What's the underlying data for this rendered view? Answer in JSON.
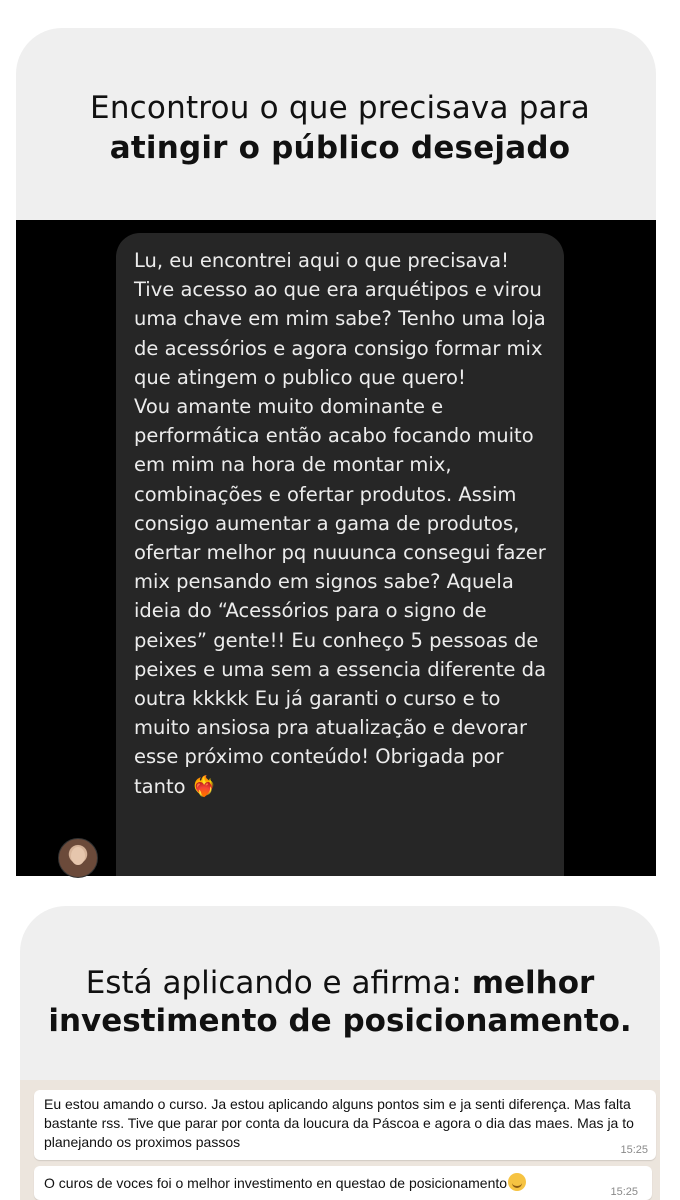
{
  "section1": {
    "headline_light": "Encontrou o que precisava para",
    "headline_bold": "atingir o público desejado"
  },
  "message": {
    "paragraph1": "Lu, eu encontrei aqui o que precisava! Tive acesso ao que era arquétipos e virou uma chave em mim sabe? Tenho uma loja de acessórios e agora consigo formar mix que atingem o publico que quero!",
    "paragraph2": "Vou amante muito dominante e performática então acabo focando muito em mim na hora de montar mix, combinações e ofertar produtos. Assim consigo aumentar a gama de produtos, ofertar melhor pq nuuunca consegui fazer mix pensando em signos sabe? Aquela ideia do “Acessórios para o signo de peixes” gente!! Eu conheço 5 pessoas de peixes e uma sem a essencia diferente da outra kkkkk Eu já garanti o curso e to muito ansiosa pra atualização e devorar esse próximo conteúdo! Obrigada por tanto",
    "emoji": "❤️‍🔥"
  },
  "section2": {
    "headline_light": "Está aplicando e afirma: ",
    "headline_bold_1": "melhor",
    "headline_bold_2": "investimento de posicionamento."
  },
  "chat": {
    "messages": [
      {
        "text": "Eu estou amando o curso. Ja estou aplicando alguns pontos sim e ja senti diferença. Mas falta bastante rss. Tive que parar por conta da loucura da Páscoa e agora o dia das maes. Mas ja to planejando os proximos passos",
        "time": "15:25"
      },
      {
        "text": "O curos de voces foi o melhor investimento en questao de posicionamento",
        "time": "15:25"
      }
    ]
  }
}
